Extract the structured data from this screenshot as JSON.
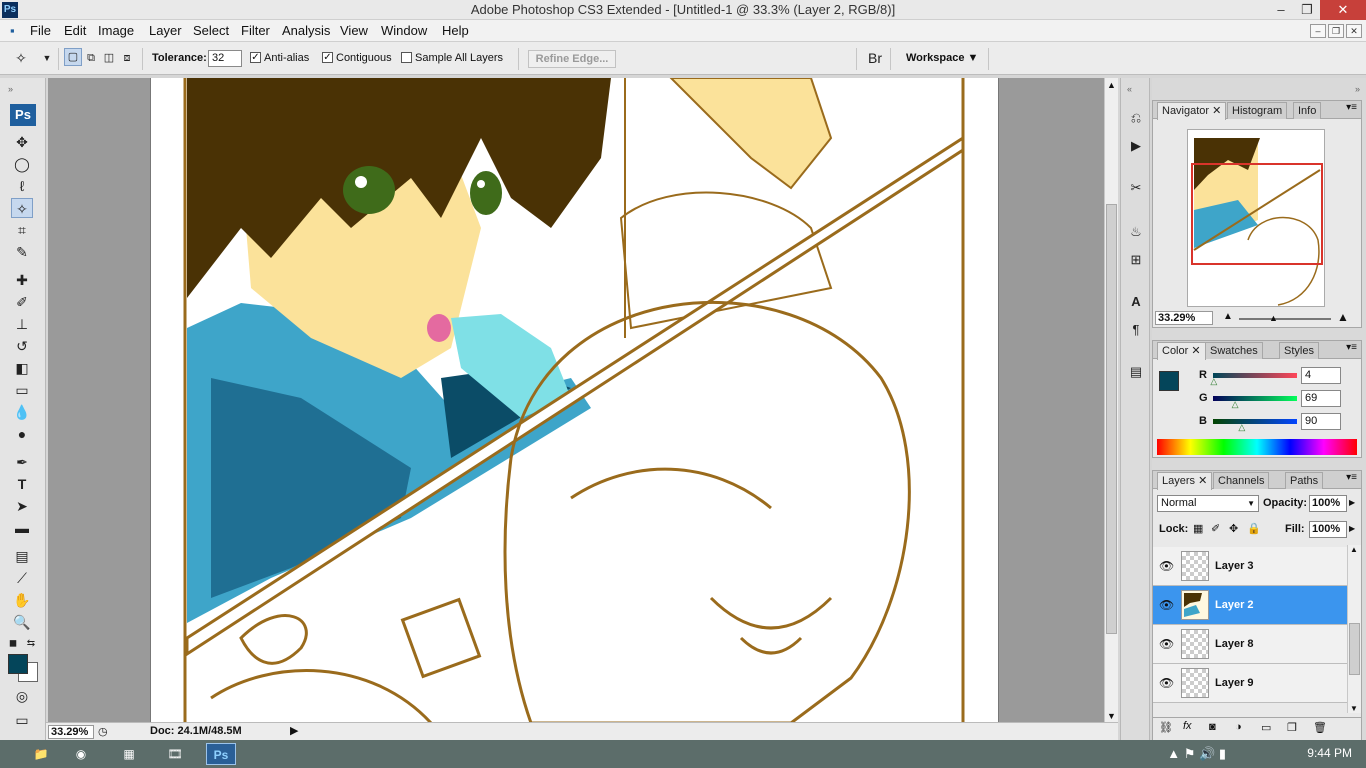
{
  "window": {
    "title": "Adobe Photoshop CS3 Extended - [Untitled-1 @ 33.3% (Layer 2, RGB/8)]",
    "logo": "Ps",
    "controls": [
      "–",
      "❐",
      "✕"
    ]
  },
  "menu": [
    "File",
    "Edit",
    "Image",
    "Layer",
    "Select",
    "Filter",
    "Analysis",
    "View",
    "Window",
    "Help"
  ],
  "options_bar": {
    "tolerance_label": "Tolerance:",
    "tolerance_value": "32",
    "anti_alias_label": "Anti-alias",
    "anti_alias_checked": true,
    "contiguous_label": "Contiguous",
    "contiguous_checked": true,
    "sample_all_label": "Sample All Layers",
    "sample_all_checked": false,
    "refine_edge_label": "Refine Edge...",
    "workspace_label": "Workspace ▼"
  },
  "toolbox": {
    "badge": "Ps",
    "tools": [
      "move-icon",
      "marquee-icon",
      "lasso-icon",
      "magic-wand-icon",
      "crop-icon",
      "slice-icon",
      "healing-icon",
      "brush-icon",
      "stamp-icon",
      "history-brush-icon",
      "eraser-icon",
      "gradient-icon",
      "blur-icon",
      "dodge-icon",
      "pen-icon",
      "type-icon",
      "path-select-icon",
      "shape-icon",
      "notes-icon",
      "eyedropper-icon",
      "hand-icon",
      "zoom-icon"
    ],
    "foreground_color": "#04455a",
    "background_color": "#ffffff"
  },
  "status": {
    "zoom": "33.29%",
    "doc": "Doc: 24.1M/48.5M"
  },
  "navigator": {
    "tabs": [
      "Navigator",
      "Histogram",
      "Info"
    ],
    "zoom": "33.29%"
  },
  "color_panel": {
    "tabs": [
      "Color",
      "Swatches",
      "Styles"
    ],
    "r_label": "R",
    "g_label": "G",
    "b_label": "B",
    "r": "4",
    "g": "69",
    "b": "90",
    "r_level": 0.016,
    "g_level": 0.27,
    "b_level": 0.35,
    "swatch": "#04455a"
  },
  "layers_panel": {
    "tabs": [
      "Layers",
      "Channels",
      "Paths"
    ],
    "blend_mode": "Normal",
    "opacity_label": "Opacity:",
    "opacity": "100%",
    "lock_label": "Lock:",
    "fill_label": "Fill:",
    "fill": "100%",
    "layers": [
      {
        "name": "Layer 3",
        "selected": false
      },
      {
        "name": "Layer 2",
        "selected": true
      },
      {
        "name": "Layer 8",
        "selected": false
      },
      {
        "name": "Layer 9",
        "selected": false
      }
    ]
  },
  "taskbar": {
    "time": "9:44 PM"
  }
}
